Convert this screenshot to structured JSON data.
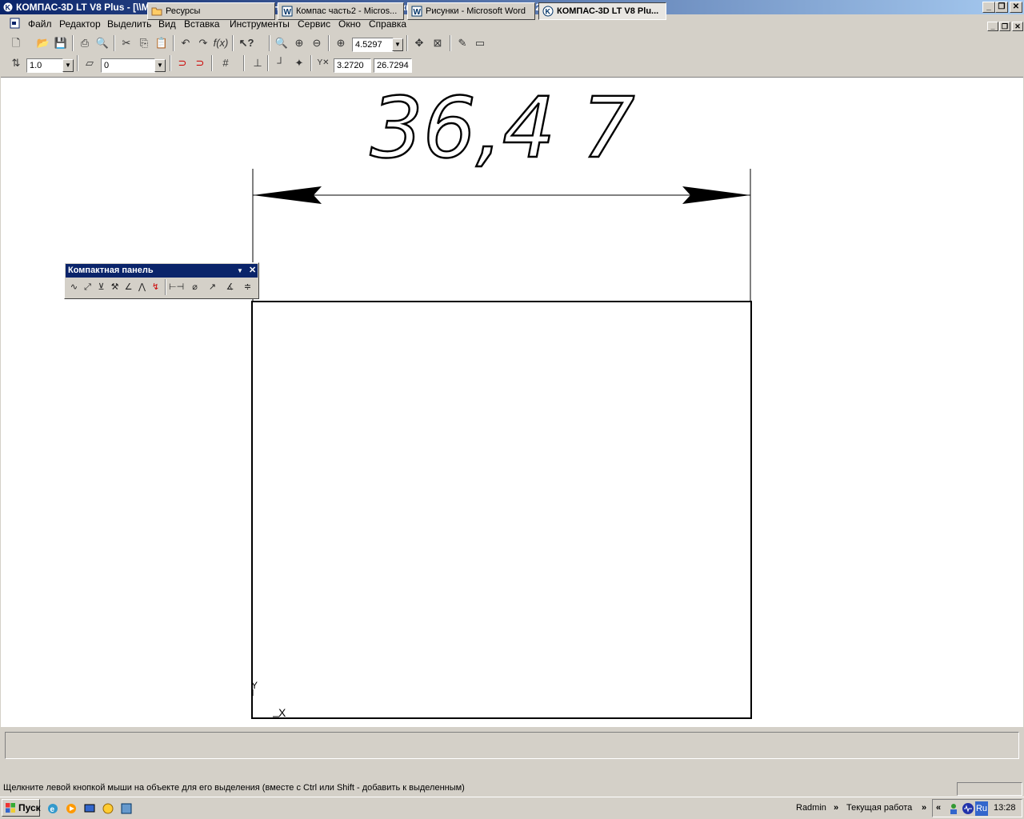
{
  "window": {
    "title": "КОМПАС-3D LT V8 Plus - [\\\\Miit-srv\\хранилище\\Архив\\_Надюша\\Кафедра\\Методички\\Методичка Компас часть 2\\Ресурсы\\Рис. 14.frw]",
    "minimize": "_",
    "maximize": "▫",
    "close": "✕"
  },
  "menu": [
    "Файл",
    "Редактор",
    "Выделить",
    "Вид",
    "Вставка",
    "Инструменты",
    "Сервис",
    "Окно",
    "Справка"
  ],
  "toolbar1": {
    "zoom_value": "4.5297"
  },
  "toolbar2": {
    "step_value": "1.0",
    "layer_value": "0",
    "coord_x": "3.2720",
    "coord_y": "26.7294",
    "coord_label": "Y"
  },
  "drawing": {
    "dimension_text": "36,4 7",
    "axis_y": "Y",
    "axis_x": "X"
  },
  "compact_panel": {
    "title": "Компактная панель"
  },
  "statusbar": {
    "hint": "Щелкните левой кнопкой мыши на объекте для его выделения (вместе с Ctrl или Shift - добавить к выделенным)"
  },
  "taskbar": {
    "start_label": "Пуск",
    "tasks": [
      {
        "label": "Ресурсы",
        "icon": "folder-icon",
        "active": false
      },
      {
        "label": "Компас часть2 - Micros...",
        "icon": "word-icon",
        "active": false
      },
      {
        "label": "Рисунки - Microsoft Word",
        "icon": "word-icon",
        "active": false
      },
      {
        "label": "КОМПАС-3D LT V8 Plu...",
        "icon": "kompas-icon",
        "active": true
      }
    ],
    "radmin": "Radmin",
    "current_work": "Текущая работа",
    "lang": "Ru",
    "clock": "13:28"
  }
}
